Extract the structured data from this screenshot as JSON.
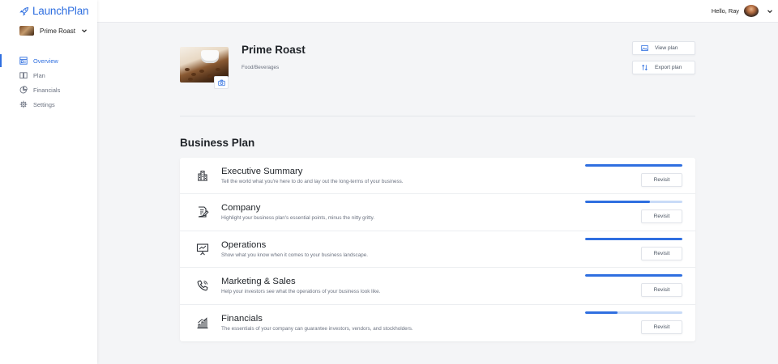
{
  "app": {
    "name": "LaunchPlan"
  },
  "sidebar": {
    "business_switcher": {
      "label": "Prime Roast"
    },
    "items": [
      {
        "label": "Overview",
        "icon": "overview-icon",
        "active": true
      },
      {
        "label": "Plan",
        "icon": "book-icon",
        "active": false
      },
      {
        "label": "Financials",
        "icon": "pie-chart-icon",
        "active": false
      },
      {
        "label": "Settings",
        "icon": "gear-icon",
        "active": false
      }
    ]
  },
  "topbar": {
    "greeting": "Hello, Ray"
  },
  "business": {
    "name": "Prime Roast",
    "category": "Food/Beverages"
  },
  "actions": {
    "view_plan": "View plan",
    "export_plan": "Export plan"
  },
  "plan": {
    "title": "Business Plan",
    "revisit_label": "Revisit",
    "sections": [
      {
        "title": "Executive Summary",
        "description": "Tell the world what you're here to do and lay out the long-terms of your business.",
        "progress": 1.0,
        "icon": "building-icon"
      },
      {
        "title": "Company",
        "description": "Highlight your business plan's essential points, minus the nitty gritty.",
        "progress": 0.67,
        "icon": "document-edit-icon"
      },
      {
        "title": "Operations",
        "description": "Show what you know when it comes to your business landscape.",
        "progress": 1.0,
        "icon": "presentation-icon"
      },
      {
        "title": "Marketing & Sales",
        "description": "Help your investors see what the operations of your business look like.",
        "progress": 1.0,
        "icon": "phone-icon"
      },
      {
        "title": "Financials",
        "description": "The essentials of your company can guarantee investors, vendors, and stockholders.",
        "progress": 0.33,
        "icon": "bar-chart-icon"
      }
    ]
  },
  "colors": {
    "accent": "#2f6fe0",
    "progress_track": "#c9dbf7"
  }
}
